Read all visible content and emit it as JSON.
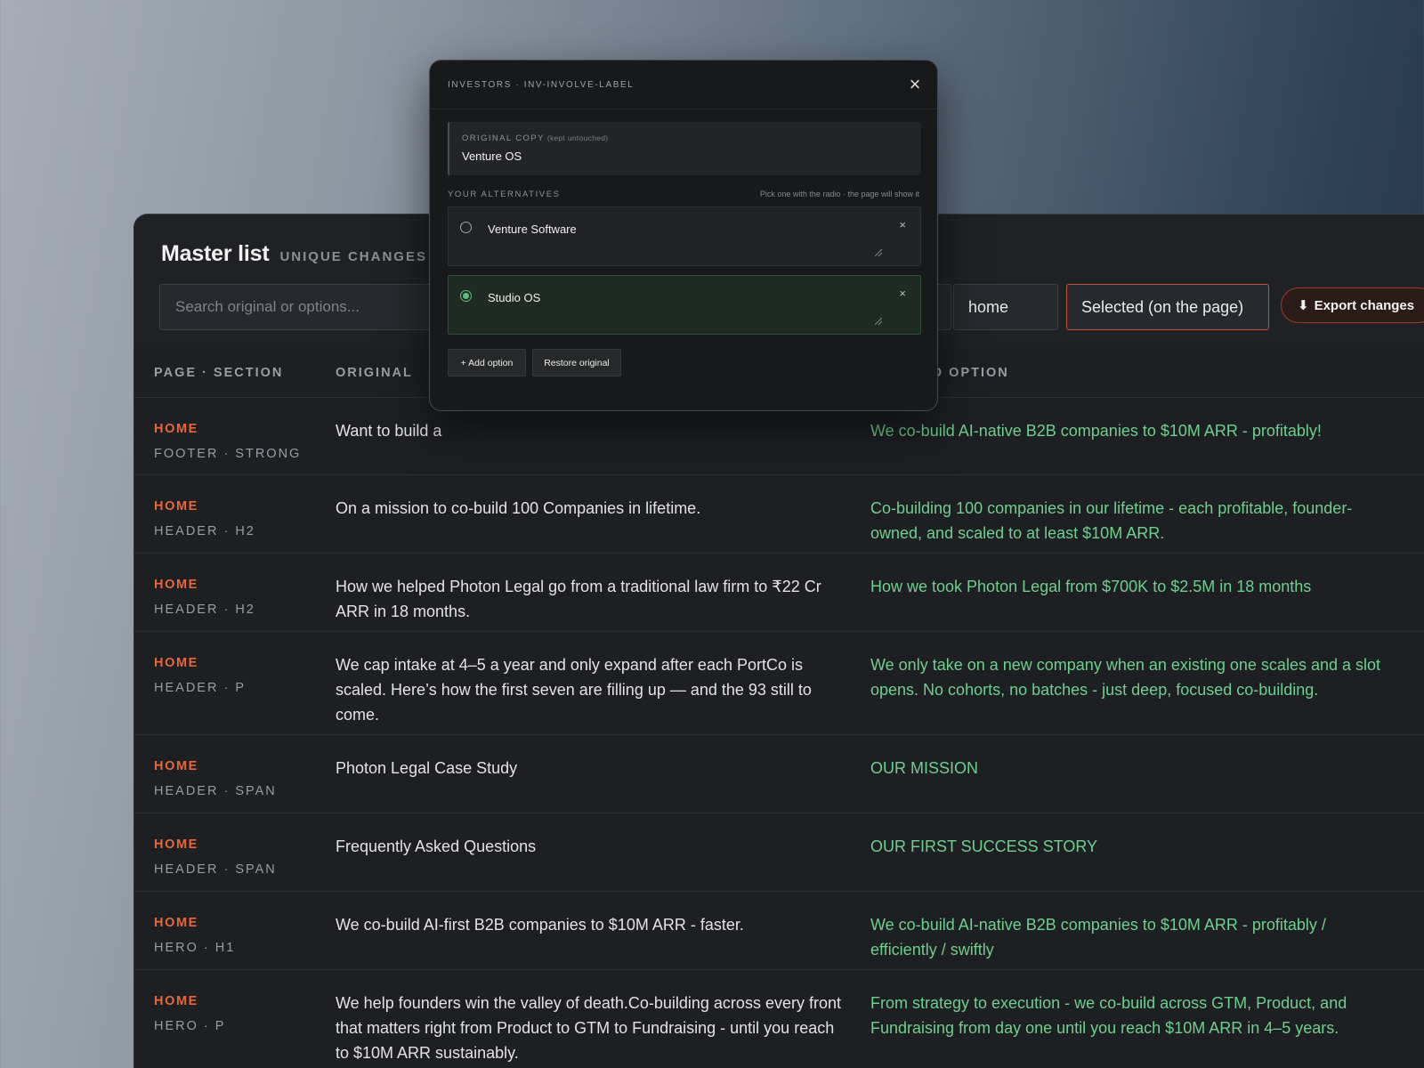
{
  "master": {
    "title": "Master list",
    "subtitle": "UNIQUE CHANGES O",
    "search_placeholder": "Search original or options...",
    "page_filter": "home",
    "mode_filter": "Selected (on the page)",
    "export_label": "Export changes",
    "export_icon": "download-arrow-icon"
  },
  "table": {
    "headers": [
      "PAGE · SECTION",
      "ORIGINAL",
      "ED OPTION"
    ],
    "rows": [
      {
        "page": "HOME",
        "section": "FOOTER · STRONG",
        "original": "Want to build a",
        "selected": "We co-build AI-native B2B companies to $10M ARR - profitably!"
      },
      {
        "page": "HOME",
        "section": "HEADER · H2",
        "original": "On a mission to co-build 100 Companies in lifetime.",
        "selected": "Co-building 100 companies in our lifetime - each profitable, founder-owned, and scaled to at least $10M ARR."
      },
      {
        "page": "HOME",
        "section": "HEADER · H2",
        "original": "How we helped Photon Legal go from a traditional law firm to ₹22 Cr ARR in 18 months.",
        "selected": "How we took Photon Legal from $700K to $2.5M in 18 months"
      },
      {
        "page": "HOME",
        "section": "HEADER · P",
        "original": "We cap intake at 4–5 a year and only expand after each PortCo is scaled. Here’s how the first seven are filling up — and the 93 still to come.",
        "selected": "We only take on a new company when an existing one scales and a slot opens. No cohorts, no batches - just deep, focused co-building."
      },
      {
        "page": "HOME",
        "section": "HEADER · SPAN",
        "original": "Photon Legal Case Study",
        "selected": "OUR MISSION"
      },
      {
        "page": "HOME",
        "section": "HEADER · SPAN",
        "original": "Frequently Asked Questions",
        "selected": "OUR FIRST SUCCESS STORY"
      },
      {
        "page": "HOME",
        "section": "HERO · H1",
        "original": "We co-build AI-first B2B companies to $10M ARR - faster.",
        "selected": "We co-build AI-native B2B companies to $10M ARR - profitably / efficiently / swiftly"
      },
      {
        "page": "HOME",
        "section": "HERO · P",
        "original": "We help founders win the valley of death.Co-building across every front that matters right from Product to GTM to Fundraising - until you reach to $10M ARR sustainably.",
        "selected": "From strategy to execution - we co-build across GTM, Product, and Fundraising from day one until you reach $10M ARR in 4–5 years."
      }
    ]
  },
  "modal": {
    "crumb": "INVESTORS · INV-INVOLVE-LABEL",
    "close_icon": "close-icon",
    "original_label": "ORIGINAL COPY",
    "original_note": "(kept untouched)",
    "original_value": "Venture OS",
    "alternatives_label": "YOUR ALTERNATIVES",
    "alternatives_hint": "Pick one with the radio · the page will show it",
    "alternatives": [
      {
        "text": "Venture Software",
        "selected": false
      },
      {
        "text": "Studio OS",
        "selected": true
      }
    ],
    "remove_glyph": "×",
    "add_label": "+ Add option",
    "restore_label": "Restore original"
  },
  "colors": {
    "accent_orange": "#e8663a",
    "selected_green": "#6fcf8e",
    "radio_green": "#5fbf7c"
  }
}
